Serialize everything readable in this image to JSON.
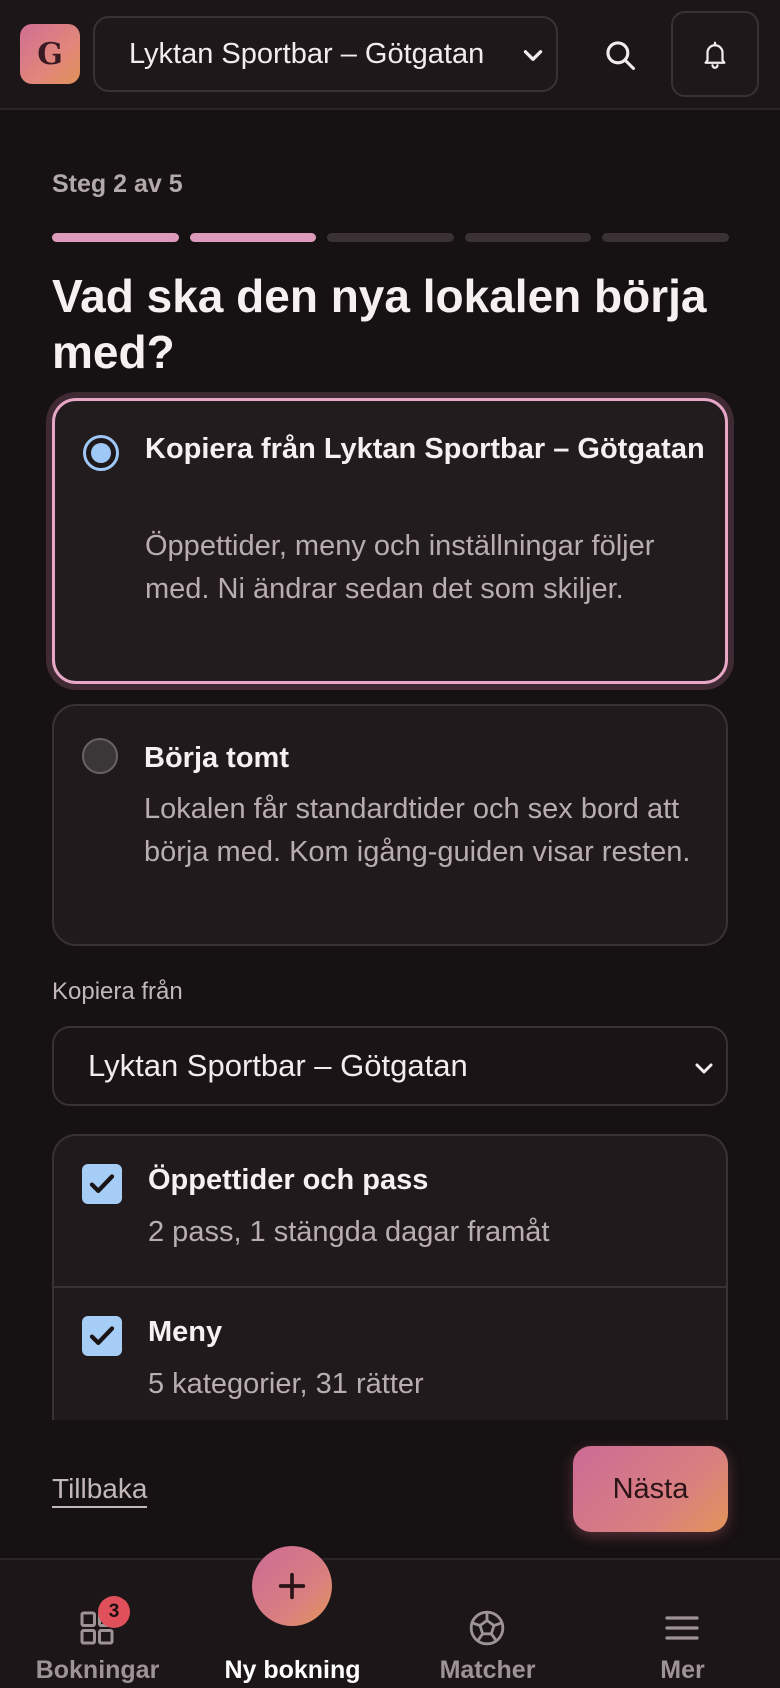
{
  "header": {
    "logo_letter": "G",
    "venue_selected": "Lyktan Sportbar – Götgatan",
    "search_icon": "search-icon",
    "bell_icon": "bell-icon"
  },
  "wizard": {
    "step_label": "Steg 2 av 5",
    "progress": {
      "current": 2,
      "total": 5
    },
    "question": "Vad ska den nya lokalen börja med?",
    "options": [
      {
        "title": "Kopiera från Lyktan Sportbar – Götgatan",
        "description": "Öppettider, meny och inställningar följer med. Ni ändrar sedan det som skiljer.",
        "selected": true
      },
      {
        "title": "Börja tomt",
        "description": "Lokalen får standardtider och sex bord att börja med. Kom igång‑guiden visar resten.",
        "selected": false
      }
    ],
    "copy_from_label": "Kopiera från",
    "copy_from_value": "Lyktan Sportbar – Götgatan",
    "checklist": [
      {
        "title": "Öppettider och pass",
        "description": "2 pass, 1 stängda dagar framåt",
        "checked": true
      },
      {
        "title": "Meny",
        "description": "5 kategorier, 31 rätter",
        "checked": true
      }
    ],
    "back_label": "Tillbaka",
    "next_label": "Nästa"
  },
  "bottom_nav": {
    "items": [
      {
        "label": "Bokningar",
        "icon": "grid-icon",
        "badge": "3"
      },
      {
        "label": "Ny bokning",
        "icon": "plus-icon",
        "active": true
      },
      {
        "label": "Matcher",
        "icon": "football-icon"
      },
      {
        "label": "Mer",
        "icon": "menu-icon"
      }
    ]
  },
  "colors": {
    "accent_pink": "#dd9abb",
    "accent_gradient_start": "#cc6b96",
    "accent_gradient_end": "#e39558",
    "checkbox_blue": "#a6cdf6",
    "badge_red": "#e0505a",
    "background": "#161112"
  }
}
